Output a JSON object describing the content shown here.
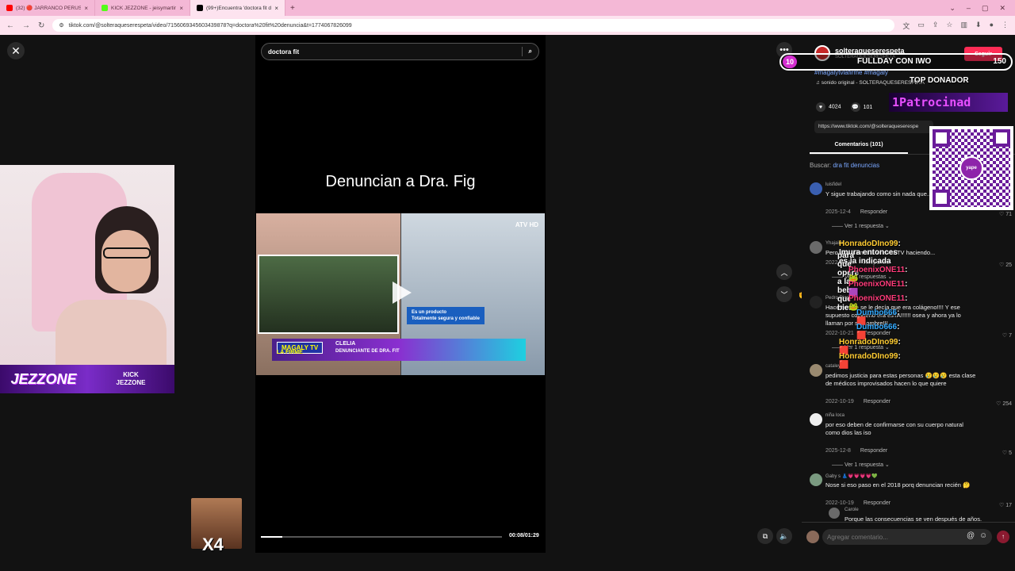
{
  "browser": {
    "tabs": [
      {
        "label": "(32) 🔴 JARRANCO PERUST 2! ¡",
        "color": "#ff0000"
      },
      {
        "label": "KICK JEZZONE - jeisymartinez",
        "color": "#53fc18"
      },
      {
        "label": "(99+)Encuentra 'doctora fit de",
        "color": "#000000"
      }
    ],
    "url": "tiktok.com/@solteraqueserespeta/video/7156069345603439878?q=doctora%20fit%20denuncia&t=1774067826099"
  },
  "tiktok": {
    "search_value": "doctora fit",
    "headline": "Denuncian a Dra. Fig",
    "video": {
      "tv_logo": "ATV HD",
      "caption_line1": "Es un producto",
      "caption_line2": "Totalmente segura y confiable",
      "program": "MAGALY TV",
      "program_sub": "LA FIRME",
      "lower_name": "CLELIA",
      "lower_role": "DENUNCIANTE DE DRA. FIT",
      "progress": 0.09,
      "timecode": "00:08/01:29"
    },
    "author": {
      "username": "solteraqueserespeta",
      "subname": "SOLTERAQUESERESPETA",
      "follow_label": "Seguir"
    },
    "hashtags": "#magalytvlafirme #magaly",
    "sound": "sonido original - SOLTERAQUESERESPETA",
    "likes": "4024",
    "comments_count": "101",
    "link": "https://www.tiktok.com/@solteraqueserespe",
    "comments_tab": "Comentarios (101)",
    "find_prefix": "Buscar:",
    "find_term": "dra fit denuncias",
    "comments": [
      {
        "user": "luisfidel",
        "text": "Y sigue trabajando como sin nada que... 💀💀",
        "date": "2025-12-4",
        "reply": "Responder",
        "likes": "71",
        "replies": "Ver 1 respuesta"
      },
      {
        "user": "Yhajaira",
        "text": "Pero esa misma la vi en la TV haciendo...",
        "date": "2022-10-19",
        "reply": "Responder",
        "likes": "25",
        "replies": "Ver 4 respuestas"
      },
      {
        "user": "Pedro Rios",
        "text": "Hace tiempo se le decía que era colágeno!!!! Y ese supuesto colágeno era esTA!!!!!! osea y ahora ya lo llaman por su nombre!!!",
        "date": "2022-10-21",
        "reply": "Responder",
        "likes": "7",
        "replies": "Ver 1 respuesta"
      },
      {
        "user": "cataleya",
        "text": "pedimos justicia para estas personas 😢😢😢 esta clase de médicos improvisados hacen lo que quiere",
        "date": "2022-10-19",
        "reply": "Responder",
        "likes": "254",
        "replies": ""
      },
      {
        "user": "niña loca",
        "text": "por eso deben de confirmarse con su cuerpo natural como dios las iso",
        "date": "2025-12-8",
        "reply": "Responder",
        "likes": "5",
        "replies": "Ver 1 respuesta"
      },
      {
        "user": "Gaby s 👗💗💗💗💗💚",
        "text": "Nose si eso paso en el 2018 porq denuncian recién 🤔",
        "date": "2022-10-19",
        "reply": "Responder",
        "likes": "17",
        "replies": ""
      }
    ],
    "nested_reply": {
      "user": "Carole",
      "text": "Porque las consecuencias se ven después de años."
    },
    "comment_placeholder": "Agregar comentario..."
  },
  "stream": {
    "brand": "JEZZONE",
    "kick_line1": "KICK",
    "kick_line2": "JEZZONE",
    "emote_mult": "X4",
    "goal_num": "10",
    "goal_title": "FULLDAY CON IWO",
    "goal_target": "150",
    "top_donor_label": "TOP DONADOR",
    "sponsor_text": "1Patrocinad",
    "qr_label": "yape",
    "chat": [
      {
        "user": "HonradoDIno99",
        "color": "#ffcc33",
        "msg": ": Imura entonces es la indicada"
      },
      {
        "user": "",
        "color": "#ffffff",
        "msg": "para que opere a la beba, que bien"
      },
      {
        "user": "PhoenixONE11",
        "color": "#ff3b7a",
        "msg": ": 🐸"
      },
      {
        "user": "PhoenixONE11",
        "color": "#ff3b7a",
        "msg": ": 🟪"
      },
      {
        "user": "PhoenixONE11",
        "color": "#ff3b7a",
        "msg": ": 🐸"
      },
      {
        "user": "Dumbo666",
        "color": "#33aaff",
        "msg": ": 🟥"
      },
      {
        "user": "Dumbo666",
        "color": "#33aaff",
        "msg": ": 🟥"
      },
      {
        "user": "HonradoDIno99",
        "color": "#ffcc33",
        "msg": ": 🟥"
      },
      {
        "user": "HonradoDIno99",
        "color": "#ffcc33",
        "msg": ": 🟥"
      }
    ]
  }
}
